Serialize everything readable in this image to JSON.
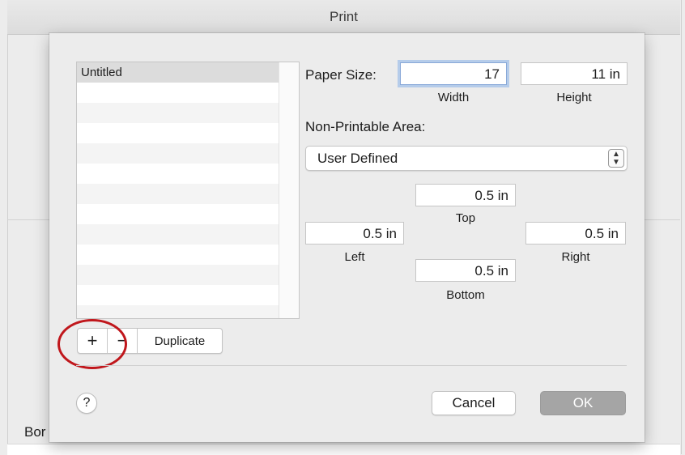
{
  "window": {
    "title": "Print"
  },
  "background": {
    "partial_text": "Bor"
  },
  "paper_list": {
    "items": [
      "Untitled"
    ],
    "selected": "Untitled"
  },
  "list_buttons": {
    "add_label": "+",
    "remove_label": "−",
    "duplicate_label": "Duplicate"
  },
  "paper_size": {
    "label": "Paper Size:",
    "width_value": "17",
    "width_caption": "Width",
    "height_value": "11 in",
    "height_caption": "Height"
  },
  "non_printable": {
    "label": "Non-Printable Area:",
    "selected_option": "User Defined",
    "top_value": "0.5 in",
    "top_caption": "Top",
    "left_value": "0.5 in",
    "left_caption": "Left",
    "right_value": "0.5 in",
    "right_caption": "Right",
    "bottom_value": "0.5 in",
    "bottom_caption": "Bottom"
  },
  "footer": {
    "help_label": "?",
    "cancel_label": "Cancel",
    "ok_label": "OK"
  },
  "colors": {
    "highlight": "#c0171c",
    "ok_button": "#a5a5a5",
    "focus_ring": "#b5ccea"
  }
}
